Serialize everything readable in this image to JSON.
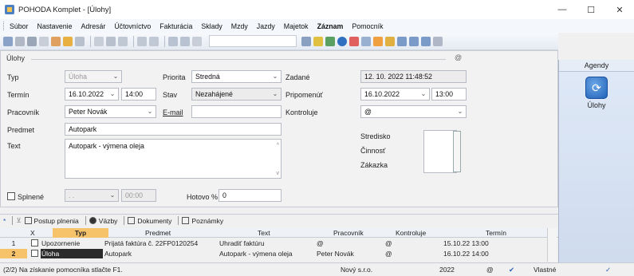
{
  "window": {
    "title": "POHODA Komplet - [Úlohy]",
    "min_label": "—",
    "max_label": "☐",
    "close_label": "✕"
  },
  "menu": [
    {
      "label": "Súbor"
    },
    {
      "label": "Nastavenie"
    },
    {
      "label": "Adresár"
    },
    {
      "label": "Účtovníctvo"
    },
    {
      "label": "Fakturácia"
    },
    {
      "label": "Sklady"
    },
    {
      "label": "Mzdy"
    },
    {
      "label": "Jazdy"
    },
    {
      "label": "Majetok"
    },
    {
      "label": "Záznam",
      "bold": true
    },
    {
      "label": "Pomocník"
    }
  ],
  "form": {
    "panel_title": "Úlohy",
    "panel_icon": "@",
    "typ_label": "Typ",
    "typ_value": "Úloha",
    "priorita_label": "Priorita",
    "priorita_value": "Stredná",
    "zadane_label": "Zadané",
    "zadane_value": "12. 10. 2022 11:48:52",
    "termin_label": "Termín",
    "termin_date": "16.10.2022",
    "termin_time": "14:00",
    "stav_label": "Stav",
    "stav_value": "Nezahájené",
    "pripomenut_label": "Pripomenúť",
    "pripomenut_date": "16.10.2022",
    "pripomenut_time": "13:00",
    "pracovnik_label": "Pracovník",
    "pracovnik_value": "Peter Novák",
    "email_label": "E-mail",
    "email_value": "",
    "kontroluje_label": "Kontroluje",
    "kontroluje_value": "@",
    "predmet_label": "Predmet",
    "predmet_value": "Autopark",
    "text_label": "Text",
    "text_value": "Autopark - výmena oleja",
    "stredisko_label": "Stredisko",
    "cinnost_label": "Činnosť",
    "zakazka_label": "Zákazka",
    "splnene_label": "Splnené",
    "splnene_date": ". .",
    "splnene_time": "00:00",
    "hotovo_label": "Hotovo %",
    "hotovo_value": "0"
  },
  "bottom_tabs": [
    {
      "label": "Postup plnenia"
    },
    {
      "label": "Väzby"
    },
    {
      "label": "Dokumenty"
    },
    {
      "label": "Poznámky"
    }
  ],
  "grid": {
    "headers": [
      "X",
      "Typ",
      "Predmet",
      "Text",
      "Pracovník",
      "Kontroluje",
      "Termín"
    ],
    "rows": [
      {
        "num": "1",
        "typ": "Upozornenie",
        "predmet": "Prijatá faktúra č. 22FP0120254",
        "text": "Uhradiť faktúru",
        "pracovnik": "@",
        "kontroluje": "@",
        "termin": "15.10.22 13:00"
      },
      {
        "num": "2",
        "typ": "Úloha",
        "predmet": "Autopark",
        "text": "Autopark - výmena oleja",
        "pracovnik": "Peter Novák",
        "kontroluje": "@",
        "termin": "16.10.22 14:00"
      }
    ]
  },
  "sidebar": {
    "header": "Agendy",
    "item_label": "Úlohy"
  },
  "status": {
    "help": "(2/2) Na získanie pomocníka stlačte F1.",
    "company": "Nový s.r.o.",
    "year": "2022",
    "icon": "@",
    "mode": "Vlastné"
  }
}
